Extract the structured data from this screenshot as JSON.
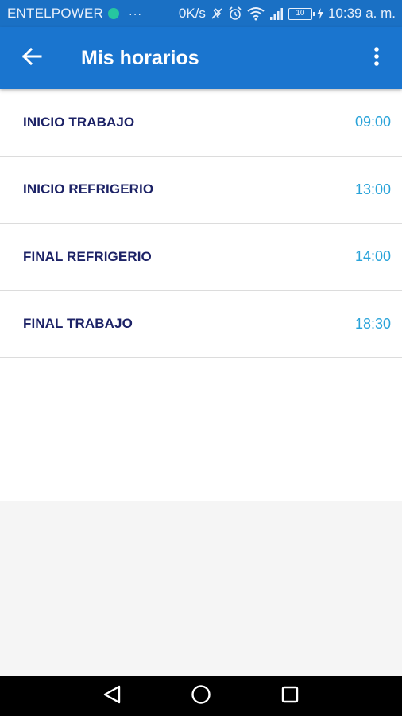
{
  "status_bar": {
    "carrier": "ENTELPOWER",
    "more": "···",
    "speed": "0K/s",
    "battery": "10",
    "time": "10:39 a. m."
  },
  "app_bar": {
    "title": "Mis horarios"
  },
  "schedule": [
    {
      "label": "INICIO TRABAJO",
      "time": "09:00"
    },
    {
      "label": "INICIO REFRIGERIO",
      "time": "13:00"
    },
    {
      "label": "FINAL REFRIGERIO",
      "time": "14:00"
    },
    {
      "label": "FINAL TRABAJO",
      "time": "18:30"
    }
  ],
  "colors": {
    "status_bar": "#1a70c4",
    "app_bar": "#1a75cf",
    "label": "#1c2266",
    "time": "#29a3d9"
  }
}
